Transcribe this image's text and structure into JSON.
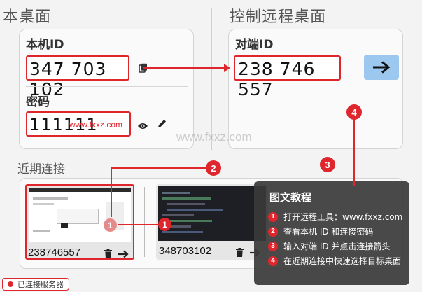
{
  "local": {
    "title": "本桌面",
    "id_label": "本机ID",
    "id_value": "347 703 102",
    "pwd_label": "密码",
    "pwd_value": "111111",
    "watermark_inline": "www.fxxz.com"
  },
  "remote": {
    "title": "控制远程桌面",
    "id_label": "对端ID",
    "id_value": "238 746 557",
    "connect_icon": "arrow-right-icon"
  },
  "recent": {
    "title": "近期连接",
    "items": [
      {
        "id": "238746557"
      },
      {
        "id": "348703102"
      }
    ]
  },
  "tutorial": {
    "title": "图文教程",
    "steps": [
      {
        "num": "1",
        "text": "打开远程工具：www.fxxz.com"
      },
      {
        "num": "2",
        "text": "查看本机 ID 和连接密码"
      },
      {
        "num": "3",
        "text": "输入对端 ID 并点击连接箭头"
      },
      {
        "num": "4",
        "text": "在近期连接中快速选择目标桌面"
      }
    ]
  },
  "markers": {
    "m1": "1",
    "m2": "2",
    "m3": "3",
    "m4": "4"
  },
  "status": {
    "text": "已连接服务器",
    "color": "#e0262d"
  },
  "watermark": "www.fxxz.com",
  "colors": {
    "accent_red": "#e0262d",
    "connect_button": "#9cc7ee"
  }
}
